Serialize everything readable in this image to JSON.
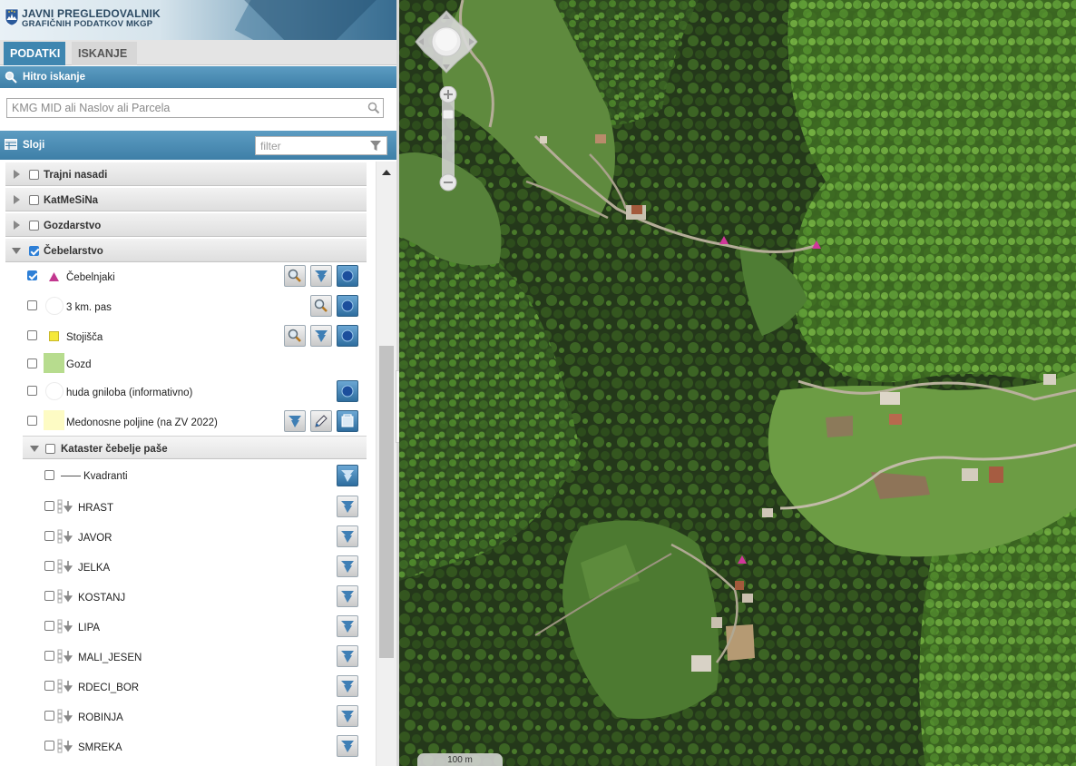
{
  "header": {
    "title_line1": "JAVNI PREGLEDOVALNIK",
    "title_line2": "GRAFIČNIH PODATKOV MKGP"
  },
  "tabs": [
    {
      "label": "PODATKI",
      "active": true
    },
    {
      "label": "ISKANJE",
      "active": false
    }
  ],
  "quick_search": {
    "title": "Hitro iskanje",
    "placeholder": "KMG MID ali Naslov ali Parcela"
  },
  "layers_panel": {
    "title": "Sloji",
    "filter_placeholder": "filter"
  },
  "groups": [
    {
      "label": "Trajni nasadi",
      "checked": false,
      "expanded": false
    },
    {
      "label": "KatMeSiNa",
      "checked": false,
      "expanded": false
    },
    {
      "label": "Gozdarstvo",
      "checked": false,
      "expanded": false
    },
    {
      "label": "Čebelarstvo",
      "checked": true,
      "expanded": true
    }
  ],
  "cebelarstvo_layers": [
    {
      "label": "Čebelnjaki",
      "checked": true,
      "symbol": "magenta-triangle",
      "buttons": [
        "zoom",
        "style",
        "info"
      ]
    },
    {
      "label": "3 km. pas",
      "checked": false,
      "symbol": "white-circle",
      "buttons": [
        "zoom",
        "info"
      ]
    },
    {
      "label": "Stojišča",
      "checked": false,
      "symbol": "yellow-square",
      "buttons": [
        "zoom",
        "style",
        "info"
      ]
    },
    {
      "label": "Gozd",
      "checked": false,
      "symbol": "green-box",
      "buttons": []
    },
    {
      "label": "huda gniloba (informativno)",
      "checked": false,
      "symbol": "white-circle",
      "buttons": [
        "info"
      ]
    },
    {
      "label": "Medonosne poljine (na ZV 2022)",
      "checked": false,
      "symbol": "cream-box",
      "buttons": [
        "style",
        "edit",
        "export"
      ]
    }
  ],
  "kataster": {
    "label": "Kataster čebelje paše",
    "checked": false,
    "layers": [
      {
        "label": "Kvadranti",
        "symbol": "line"
      },
      {
        "label": "HRAST",
        "symbol": "legend-arrow"
      },
      {
        "label": "JAVOR",
        "symbol": "legend-arrow"
      },
      {
        "label": "JELKA",
        "symbol": "legend-arrow"
      },
      {
        "label": "KOSTANJ",
        "symbol": "legend-arrow"
      },
      {
        "label": "LIPA",
        "symbol": "legend-arrow"
      },
      {
        "label": "MALI_JESEN",
        "symbol": "legend-arrow"
      },
      {
        "label": "RDECI_BOR",
        "symbol": "legend-arrow"
      },
      {
        "label": "ROBINJA",
        "symbol": "legend-arrow"
      },
      {
        "label": "SMREKA",
        "symbol": "legend-arrow"
      }
    ]
  },
  "map": {
    "scale_label": "100 m",
    "marker_color": "#d1379a"
  },
  "colors": {
    "accent_blue": "#3f86b0",
    "checkbox_blue": "#2e7fd6"
  }
}
